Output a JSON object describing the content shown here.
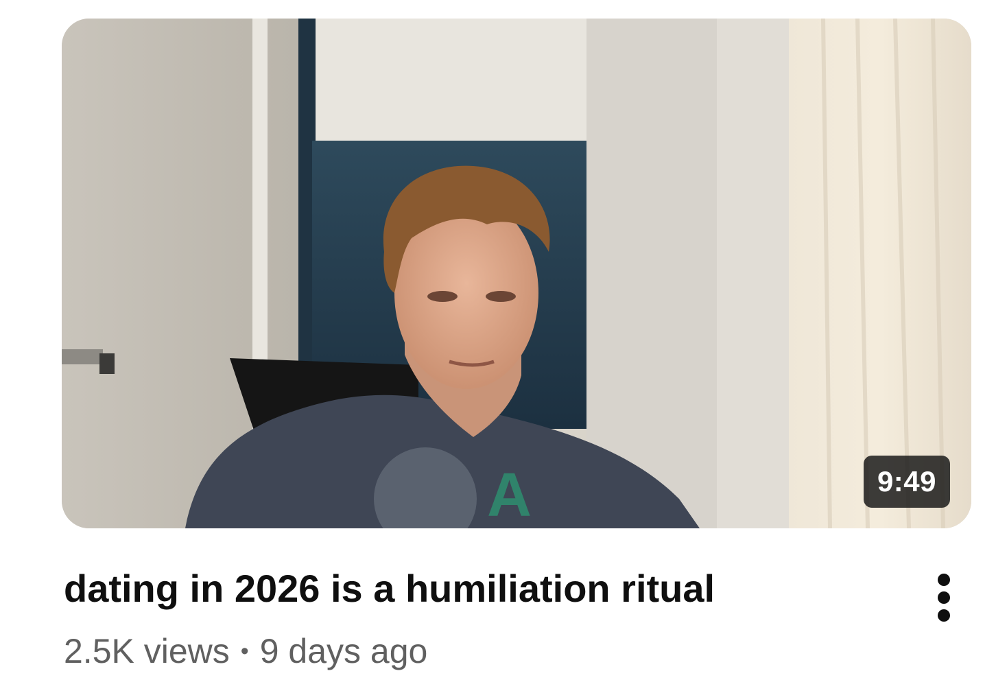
{
  "video": {
    "title": "dating in 2026 is a humiliation ritual",
    "duration": "9:49",
    "views": "2.5K views",
    "separator": "•",
    "age": "9 days ago"
  },
  "icons": {
    "menu": "more-vertical-icon"
  },
  "colors": {
    "title": "#0f0f0f",
    "meta": "#606060",
    "duration_bg": "#141414"
  }
}
